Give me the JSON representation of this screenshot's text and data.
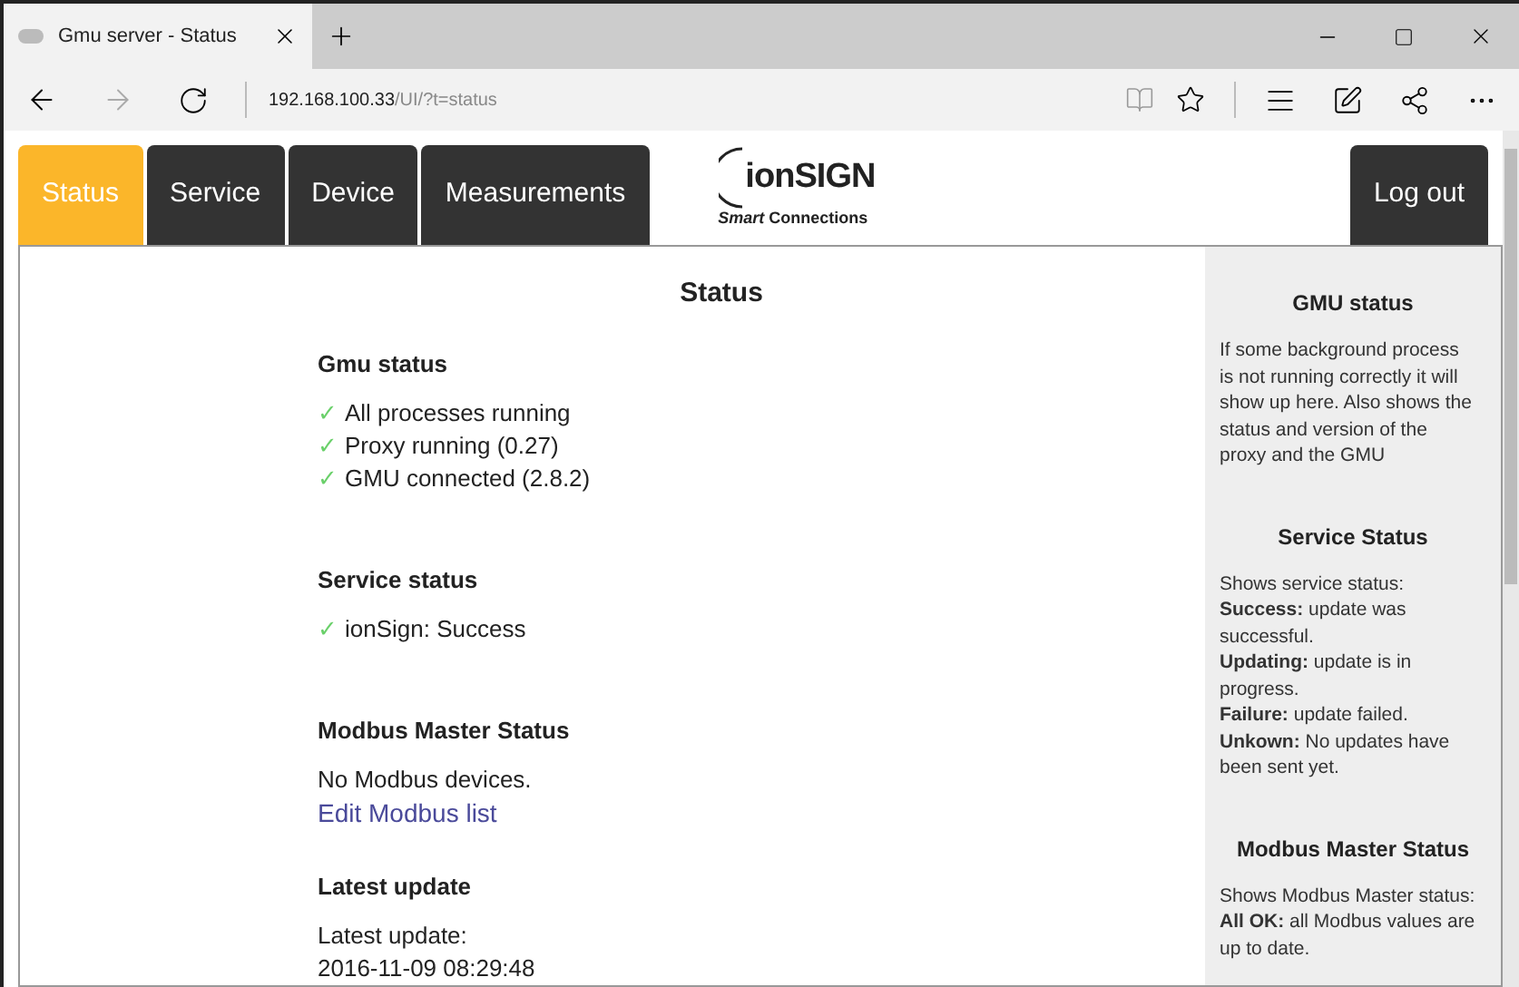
{
  "browser": {
    "tab_title": "Gmu server - Status",
    "url_host": "192.168.100.33",
    "url_path": "/UI/?t=status"
  },
  "nav": {
    "tabs": [
      {
        "label": "Status",
        "selected": true
      },
      {
        "label": "Service",
        "selected": false
      },
      {
        "label": "Device",
        "selected": false
      },
      {
        "label": "Measurements",
        "selected": false
      }
    ],
    "logo": {
      "wordmark": "ionSIGN",
      "tagline": "*Smart* Connections"
    },
    "logout": "Log out"
  },
  "main": {
    "title": "Status",
    "sections": [
      {
        "heading": "Gmu status",
        "items": [
          {
            "kind": "check",
            "mark": "✓",
            "text": "All processes running"
          },
          {
            "kind": "check",
            "mark": "✓",
            "text": "Proxy running (0.27)"
          },
          {
            "kind": "check",
            "mark": "✓",
            "text": "GMU connected (2.8.2)"
          }
        ]
      },
      {
        "heading": "Service status",
        "items": [
          {
            "kind": "check",
            "mark": "✓",
            "text": "ionSign: Success"
          }
        ]
      },
      {
        "heading": "Modbus Master Status",
        "items": [
          {
            "kind": "text",
            "text": "No Modbus devices."
          },
          {
            "kind": "link",
            "text": "Edit Modbus list"
          }
        ]
      },
      {
        "heading": "Latest update",
        "items": [
          {
            "kind": "text",
            "text": "Latest update:"
          },
          {
            "kind": "text",
            "text": "2016-11-09 08:29:48"
          }
        ]
      }
    ]
  },
  "sidebar": {
    "sections": [
      {
        "heading": "GMU status",
        "paragraphs": [
          "If some background process is not running correctly it will show up here. Also shows the status and version of the proxy and the GMU"
        ]
      },
      {
        "heading": "Service Status",
        "paragraphs": [
          "Shows service status:",
          "**Success:** update was successful.",
          "**Updating:** update is in progress.",
          "**Failure:** update failed.",
          "**Unkown:** No updates have been sent yet."
        ]
      },
      {
        "heading": "Modbus Master Status",
        "paragraphs": [
          "Shows Modbus Master status:",
          "**All OK:** all Modbus values are up to date."
        ]
      }
    ]
  }
}
